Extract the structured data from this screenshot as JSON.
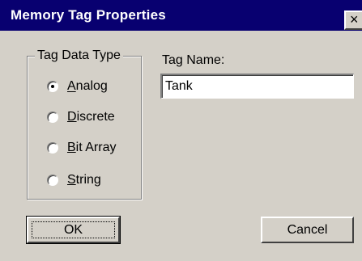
{
  "window": {
    "title": "Memory Tag Properties",
    "close_glyph": "×"
  },
  "tag_data_type": {
    "legend": "Tag Data Type",
    "options": [
      {
        "label": "Analog",
        "selected": true
      },
      {
        "label": "Discrete",
        "selected": false
      },
      {
        "label": "Bit Array",
        "selected": false
      },
      {
        "label": "String",
        "selected": false
      }
    ]
  },
  "tag_name": {
    "label": "Tag Name:",
    "value": "Tank"
  },
  "buttons": {
    "ok": "OK",
    "cancel": "Cancel"
  },
  "colors": {
    "titlebar": "#080070",
    "face": "#d4d0c8"
  }
}
